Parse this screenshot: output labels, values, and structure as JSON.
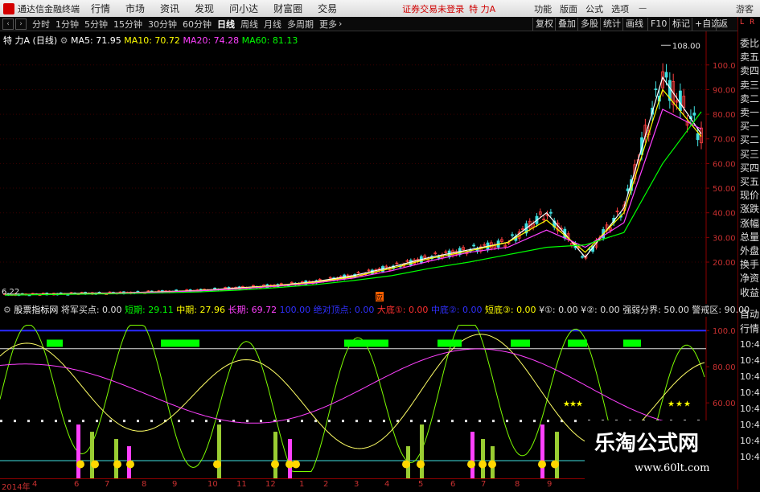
{
  "app": {
    "title": "通达信金融终端",
    "menus": [
      "行情",
      "市场",
      "资讯",
      "发现",
      "问小达",
      "财富圈",
      "交易"
    ],
    "notice": "证券交易未登录",
    "stock_name": "特 力A",
    "right_menus": [
      "功能",
      "版面",
      "公式",
      "选项"
    ],
    "guest": "游客"
  },
  "toolbar": {
    "periods": [
      "分时",
      "1分钟",
      "5分钟",
      "15分钟",
      "30分钟",
      "60分钟",
      "日线",
      "周线",
      "月线",
      "多周期",
      "更多"
    ],
    "active_period": "日线",
    "buttons": [
      "复权",
      "叠加",
      "多股",
      "统计",
      "画线",
      "F10",
      "标记",
      "+自选",
      "返回"
    ]
  },
  "main_header": {
    "stock": "特 力A",
    "cycle": "(日线)",
    "ma": [
      {
        "label": "MA5: 71.95",
        "color": "#ffffff"
      },
      {
        "label": "MA10: 70.72",
        "color": "#ffff00"
      },
      {
        "label": "MA20: 74.28",
        "color": "#ff40ff"
      },
      {
        "label": "MA60: 81.13",
        "color": "#00ff00"
      }
    ]
  },
  "price_axis": [
    "100.0",
    "90.00",
    "80.00",
    "70.00",
    "60.00",
    "50.00",
    "40.00",
    "30.00",
    "20.00"
  ],
  "price_annotations": {
    "high": "108.00",
    "low": "6.22",
    "marker": "应"
  },
  "indicator_header": {
    "name": "股票指标网",
    "items": [
      {
        "label": "将军买点: 0.00",
        "color": "#e0e0e0"
      },
      {
        "label": "短期: 29.11",
        "color": "#00ff00"
      },
      {
        "label": "中期: 27.96",
        "color": "#ffff00"
      },
      {
        "label": "长期: 69.72",
        "color": "#ff40ff"
      },
      {
        "label": "100.00",
        "color": "#3030ff"
      },
      {
        "label": "绝对顶点: 0.00",
        "color": "#3030ff"
      },
      {
        "label": "大底①: 0.00",
        "color": "#ff3030"
      },
      {
        "label": "中底②: 0.00",
        "color": "#3030ff"
      },
      {
        "label": "短底③: 0.00",
        "color": "#ffff00"
      },
      {
        "label": "¥①: 0.00",
        "color": "#e0e0e0"
      },
      {
        "label": "¥②: 0.00",
        "color": "#e0e0e0"
      },
      {
        "label": "强弱分界: 50.00",
        "color": "#e0e0e0"
      },
      {
        "label": "警戒区: 90.00",
        "color": "#e0e0e0"
      }
    ]
  },
  "indicator_axis": [
    "100.0",
    "80.00",
    "60.00",
    "40.00"
  ],
  "date_axis": [
    "2014年",
    "4",
    "6",
    "7",
    "8",
    "9",
    "10",
    "11",
    "12",
    "1",
    "2",
    "3",
    "4",
    "5",
    "6",
    "7",
    "8",
    "9"
  ],
  "right_panel": {
    "tag_top": "L",
    "tag_top2": "R",
    "quote_labels": [
      "委比",
      "卖五",
      "卖四",
      "卖三",
      "卖二",
      "卖一",
      "买一",
      "买二",
      "买三",
      "买四",
      "买五",
      "现价",
      "涨跌",
      "涨幅",
      "总量",
      "外盘",
      "换手",
      "净资",
      "收益"
    ],
    "auto_label": "自动",
    "trade_label": "行情",
    "times": [
      "10:4",
      "10:4",
      "10:4",
      "10:4",
      "10:4",
      "10:4",
      "10:4",
      "10:4"
    ]
  },
  "watermark": {
    "name": "乐淘公式网",
    "url": "www.60lt.com"
  },
  "chart_data": {
    "type": "line",
    "title": "特 力A (日线)",
    "xlabel": "",
    "ylabel": "",
    "ylim": [
      5,
      112
    ],
    "x": [
      "2014-03",
      "2014-04",
      "2014-06",
      "2014-07",
      "2014-08",
      "2014-09",
      "2014-10",
      "2014-11",
      "2014-12",
      "2015-01",
      "2015-02",
      "2015-03",
      "2015-04",
      "2015-05",
      "2015-06",
      "2015-07",
      "2015-08",
      "2015-09",
      "2015-10"
    ],
    "series": [
      {
        "name": "MA5",
        "color": "#ffffff",
        "values": [
          6.8,
          7.0,
          7.3,
          7.5,
          8.0,
          8.5,
          9.5,
          10.5,
          12.0,
          14.5,
          18.0,
          22.0,
          25.0,
          28.0,
          40.0,
          22.0,
          42.0,
          95.0,
          72.0
        ]
      },
      {
        "name": "MA10",
        "color": "#ffff00",
        "values": [
          6.8,
          7.0,
          7.2,
          7.5,
          7.9,
          8.4,
          9.3,
          10.4,
          11.8,
          14.0,
          17.5,
          21.5,
          24.5,
          28.0,
          37.0,
          24.0,
          40.0,
          90.0,
          71.0
        ]
      },
      {
        "name": "MA20",
        "color": "#ff40ff",
        "values": [
          6.7,
          6.9,
          7.1,
          7.4,
          7.8,
          8.3,
          9.1,
          10.2,
          11.5,
          13.5,
          16.5,
          20.5,
          24.0,
          26.0,
          33.0,
          26.0,
          36.0,
          82.0,
          74.0
        ]
      },
      {
        "name": "MA60",
        "color": "#00ff00",
        "values": [
          6.6,
          6.8,
          7.0,
          7.2,
          7.5,
          7.9,
          8.6,
          9.6,
          10.8,
          12.5,
          14.5,
          17.5,
          20.0,
          23.0,
          26.0,
          27.0,
          32.0,
          60.0,
          81.0
        ]
      }
    ],
    "indicator": {
      "ylim": [
        20,
        105
      ],
      "lines": {
        "强弱分界": 50,
        "警戒区": 90
      }
    }
  }
}
